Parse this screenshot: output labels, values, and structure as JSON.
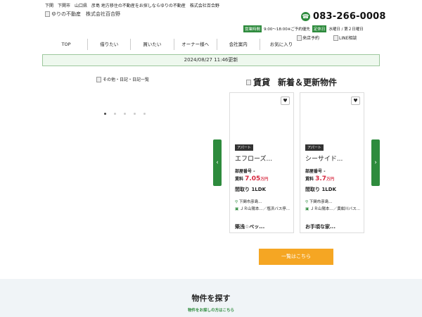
{
  "header": {
    "tagline": "下関　下関市　山口県　彦島 地方移住の不動産をお探しならゆりの不動産　株式会社百合野",
    "logo_alt": "ゆりの不動産　株式会社百合野",
    "phone": "083-266-0008",
    "hours_label": "営業時間",
    "hours_value": "9:00～18:00※ご予約優先",
    "holiday_label": "定休日",
    "holiday_value": "水曜日 / 第２日曜日",
    "visit_label": "来店予約",
    "line_label": "LINE相談"
  },
  "nav": {
    "items": [
      "TOP",
      "借りたい",
      "買いたい",
      "オーナー様へ",
      "会社案内",
      "お気に入り"
    ]
  },
  "updated": {
    "text": "2024/08/27 11:46更新"
  },
  "diary": {
    "alt": "その他・日記・日記一覧"
  },
  "listings": {
    "title_img_alt": "賃貸",
    "title": "新着＆更新物件",
    "cards": [
      {
        "category": "アパート",
        "name": "エフローズ...",
        "room_label": "部屋番号 -",
        "rent_label": "賃料",
        "rent_value": "7.05",
        "rent_unit": "万円",
        "layout_label": "間取り",
        "layout_value": "1LDK",
        "location": "下関市彦島...",
        "route": "ＪＲ山陽本...／塩浜バス停...",
        "catch": "築浅☆ペッ..."
      },
      {
        "category": "アパート",
        "name": "シーサイド...",
        "room_label": "部屋番号 -",
        "rent_label": "賃料",
        "rent_value": "3.7",
        "rent_unit": "万円",
        "layout_label": "間取り",
        "layout_value": "1LDK",
        "location": "下関市彦島...",
        "route": "ＪＲ山陽本...／黄紺川バス...",
        "catch": "お手頃な家..."
      }
    ],
    "list_button": "一覧はこちら"
  },
  "search": {
    "title": "物件を探す",
    "subtitle": "物件をお探しの方はこちら"
  },
  "colors": {
    "brand_green": "#2e8b3d",
    "price_red": "#d7263d",
    "button_orange": "#f5a623"
  }
}
